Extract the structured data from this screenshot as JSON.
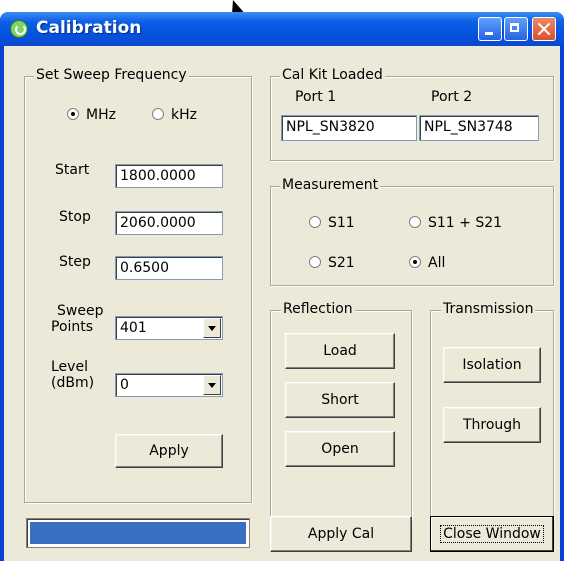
{
  "window": {
    "title": "Calibration"
  },
  "sweep": {
    "legend": "Set Sweep Frequency",
    "units": [
      {
        "label": "MHz",
        "checked": true
      },
      {
        "label": "kHz",
        "checked": false
      }
    ],
    "start_label": "Start",
    "start_value": "1800.0000",
    "stop_label": "Stop",
    "stop_value": "2060.0000",
    "step_label": "Step",
    "step_value": "0.6500",
    "points_label_1": "Sweep",
    "points_label_2": "Points",
    "points_value": "401",
    "level_label_1": "Level",
    "level_label_2": "(dBm)",
    "level_value": "0",
    "apply_label": "Apply"
  },
  "calkit": {
    "legend": "Cal Kit Loaded",
    "port1_label": "Port 1",
    "port1_value": "NPL_SN3820",
    "port2_label": "Port 2",
    "port2_value": "NPL_SN3748"
  },
  "measurement": {
    "legend": "Measurement",
    "options": [
      {
        "label": "S11",
        "checked": false
      },
      {
        "label": "S11 + S21",
        "checked": false
      },
      {
        "label": "S21",
        "checked": false
      },
      {
        "label": "All",
        "checked": true
      }
    ]
  },
  "reflection": {
    "legend": "Reflection",
    "load_label": "Load",
    "short_label": "Short",
    "open_label": "Open"
  },
  "transmission": {
    "legend": "Transmission",
    "isolation_label": "Isolation",
    "through_label": "Through"
  },
  "footer": {
    "progress_fraction": 1.0,
    "apply_cal_label": "Apply Cal",
    "close_label": "Close Window"
  },
  "colors": {
    "title_bar": "#0a5ee8",
    "dialog_bg": "#ece9d8",
    "progress_fill": "#3a6fc2",
    "close_button": "#d9502b"
  }
}
